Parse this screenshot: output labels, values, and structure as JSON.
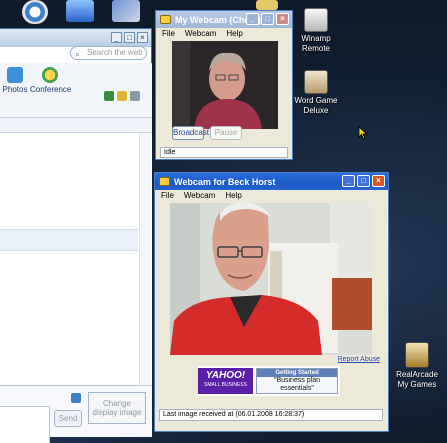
{
  "desktop_icons": [
    {
      "name": "winamp-remote",
      "label_line1": "Winamp",
      "label_line2": "Remote"
    },
    {
      "name": "word-game-deluxe",
      "label_line1": "Word Game",
      "label_line2": "Deluxe"
    },
    {
      "name": "realarcade-my-games",
      "label_line1": "RealArcade",
      "label_line2": "My Games"
    }
  ],
  "messenger": {
    "search_placeholder": "Search the web",
    "tools": [
      {
        "label": "Photos"
      },
      {
        "label": "Conference"
      }
    ],
    "send_label": "Send",
    "change_image_line1": "Change",
    "change_image_line2": "display image"
  },
  "my_webcam": {
    "title": "My Webcam (Chery)",
    "menu": [
      "File",
      "Webcam",
      "Help"
    ],
    "broadcast_label": "Broadcast",
    "pause_label": "Pause",
    "status": "Idle"
  },
  "friend_webcam": {
    "title": "Webcam for Beck Horst",
    "menu": [
      "File",
      "Webcam",
      "Help"
    ],
    "report_abuse": "Report Abuse",
    "ad": {
      "brand": "YAHOO!",
      "brand_sub": "SMALL BUSINESS",
      "header": "Getting Started",
      "text_line1": "\"Business plan",
      "text_line2": "essentials\""
    },
    "status": "Last image received at (06.01.2008 16:28:37)"
  },
  "colors": {
    "title_active": "#1c58c6",
    "title_inactive": "#9fb6d8",
    "yahoo_purple": "#5a1ea8"
  }
}
